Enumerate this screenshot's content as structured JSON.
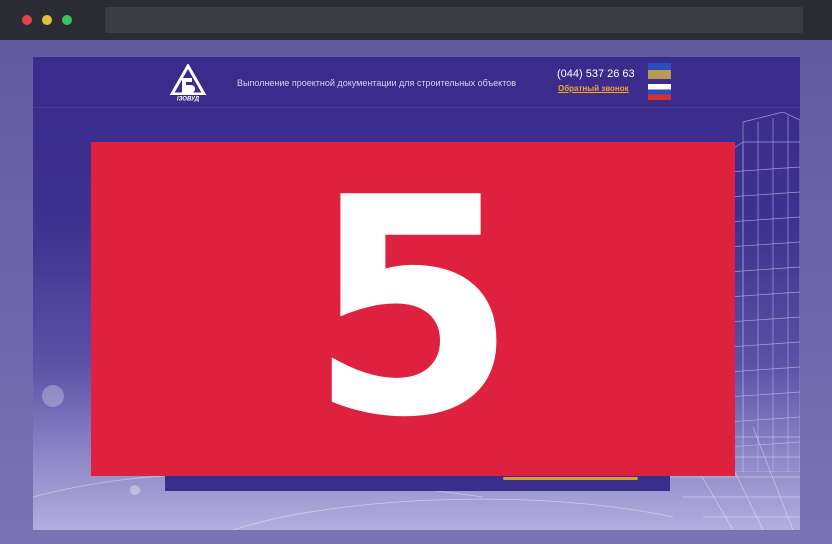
{
  "site": {
    "tagline": "Выполнение проектной документации для строительных объектов",
    "phone": "(044) 537 26 63",
    "callback_label": "Обратный звонок",
    "logo_text": "ІЗОВУД"
  },
  "overlay": {
    "number": "5",
    "color": "#df2140"
  },
  "colors": {
    "site_bg": "#3a2b8c",
    "accent": "#f5a623",
    "chrome": "#2b2c33"
  }
}
